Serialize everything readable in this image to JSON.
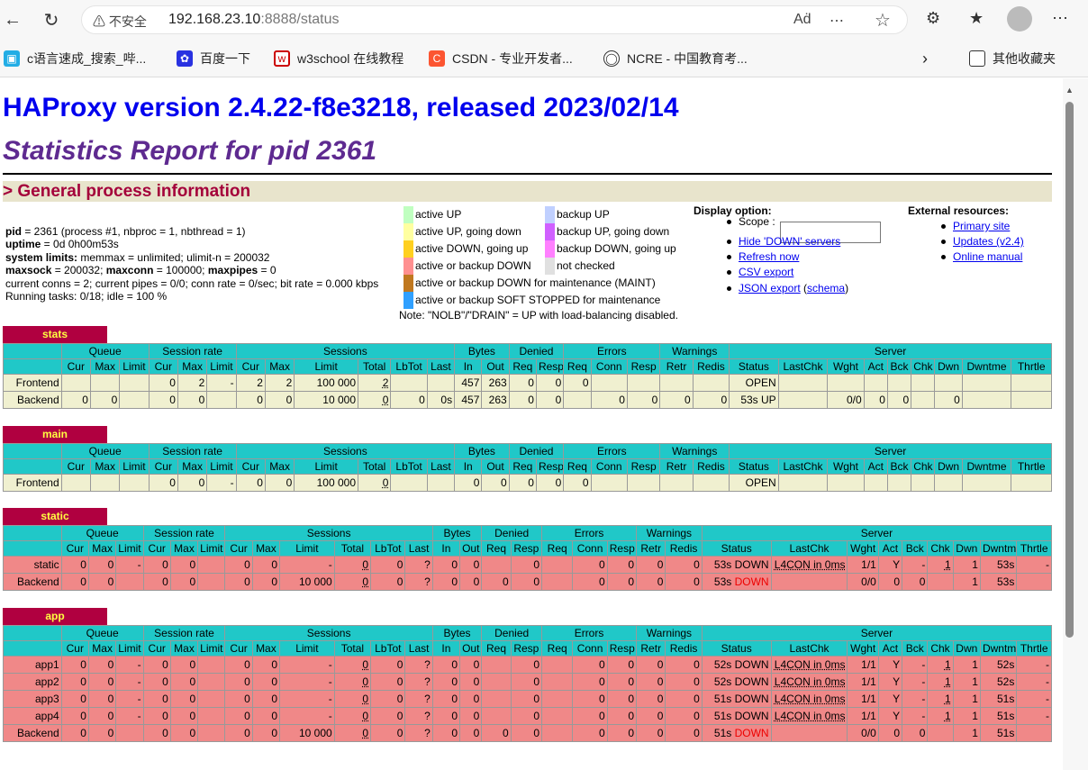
{
  "browser": {
    "security": "不安全",
    "url_host": "192.168.23.10",
    "url_rest": ":8888/status"
  },
  "bookmarks": [
    "c语言速成_搜索_哔...",
    "百度一下",
    "w3school 在线教程",
    "CSDN - 专业开发者...",
    "NCRE - 中国教育考...",
    "其他收藏夹"
  ],
  "page": {
    "title": "HAProxy version 2.4.22-f8e3218, released 2023/02/14",
    "subtitle": "Statistics Report for pid 2361",
    "section": "> General process information"
  },
  "proc": {
    "l1b": "pid",
    "l1": " = 2361 (process #1, nbproc = 1, nbthread = 1)",
    "l2b": "uptime",
    "l2": " = 0d 0h00m53s",
    "l3b": "system limits:",
    "l3": " memmax = unlimited; ulimit-n = 200032",
    "l4b1": "maxsock",
    "l4a": " = 200032; ",
    "l4b2": "maxconn",
    "l4c": " = 100000; ",
    "l4b3": "maxpipes",
    "l4d": " = 0",
    "l5": "current conns = 2; current pipes = 0/0; conn rate = 0/sec; bit rate = 0.000 kbps",
    "l6": "Running tasks: 0/18; idle = 100 %"
  },
  "legend": [
    {
      "label": "active UP",
      "color": "#c0ffc0"
    },
    {
      "label": "active UP, going down",
      "color": "#ffffa0"
    },
    {
      "label": "active DOWN, going up",
      "color": "#ffd020"
    },
    {
      "label": "active or backup DOWN",
      "color": "#ff9090"
    },
    {
      "label": "active or backup DOWN for maintenance (MAINT)",
      "color": "#c07820"
    },
    {
      "label": "active or backup SOFT STOPPED for maintenance",
      "color": "#30a0ff"
    },
    {
      "label": "backup UP",
      "color": "#c0d0ff"
    },
    {
      "label": "backup UP, going down",
      "color": "#d060ff"
    },
    {
      "label": "backup DOWN, going up",
      "color": "#ff80ff"
    },
    {
      "label": "not checked",
      "color": "#e0e0e0"
    }
  ],
  "legend_note": "Note: \"NOLB\"/\"DRAIN\" = UP with load-balancing disabled.",
  "display": {
    "title": "Display option:",
    "scope": "Scope :",
    "hide": "Hide 'DOWN' servers",
    "refresh": "Refresh now",
    "csv": "CSV export",
    "json": "JSON export",
    "schema": "schema"
  },
  "external": {
    "title": "External resources:",
    "primary": "Primary site",
    "updates": "Updates (v2.4)",
    "manual": "Online manual"
  },
  "proxies": {
    "stats": "stats",
    "main": "main",
    "static": "static",
    "app": "app"
  },
  "headers": {
    "queue": "Queue",
    "srate": "Session rate",
    "sessions": "Sessions",
    "bytes": "Bytes",
    "denied": "Denied",
    "errors": "Errors",
    "warnings": "Warnings",
    "server": "Server",
    "sub": [
      "Cur",
      "Max",
      "Limit",
      "Cur",
      "Max",
      "Limit",
      "Cur",
      "Max",
      "Limit",
      "Total",
      "LbTot",
      "Last",
      "In",
      "Out",
      "Req",
      "Resp",
      "Req",
      "Conn",
      "Resp",
      "Retr",
      "Redis",
      "Status",
      "LastChk",
      "Wght",
      "Act",
      "Bck",
      "Chk",
      "Dwn",
      "Dwntme",
      "Thrtle"
    ]
  },
  "rows": {
    "stats": [
      [
        "Frontend",
        "",
        "",
        "",
        "0",
        "2",
        "-",
        "2",
        "2",
        "100 000",
        "2",
        "",
        "",
        "457",
        "263",
        "0",
        "0",
        "0",
        "",
        "",
        "",
        "",
        "OPEN",
        "",
        "",
        "",
        "",
        "",
        "",
        "",
        ""
      ],
      [
        "Backend",
        "0",
        "0",
        "",
        "0",
        "0",
        "",
        "0",
        "0",
        "10 000",
        "0",
        "0",
        "0s",
        "457",
        "263",
        "0",
        "0",
        "",
        "0",
        "0",
        "0",
        "0",
        "53s UP",
        "",
        "0/0",
        "0",
        "0",
        "",
        "0",
        "",
        ""
      ]
    ],
    "main": [
      [
        "Frontend",
        "",
        "",
        "",
        "0",
        "0",
        "-",
        "0",
        "0",
        "100 000",
        "0",
        "",
        "",
        "0",
        "0",
        "0",
        "0",
        "0",
        "",
        "",
        "",
        "",
        "OPEN",
        "",
        "",
        "",
        "",
        "",
        "",
        "",
        ""
      ]
    ],
    "static": [
      [
        "static",
        "0",
        "0",
        "-",
        "0",
        "0",
        "",
        "0",
        "0",
        "-",
        "0",
        "0",
        "?",
        "0",
        "0",
        "",
        "0",
        "",
        "0",
        "0",
        "0",
        "0",
        "53s DOWN",
        "L4CON in 0ms",
        "1/1",
        "Y",
        "-",
        "1",
        "1",
        "53s",
        "-"
      ],
      [
        "Backend",
        "0",
        "0",
        "",
        "0",
        "0",
        "",
        "0",
        "0",
        "10 000",
        "0",
        "0",
        "?",
        "0",
        "0",
        "0",
        "0",
        "",
        "0",
        "0",
        "0",
        "0",
        "53s DOWN",
        "",
        "0/0",
        "0",
        "0",
        "",
        "1",
        "53s",
        ""
      ]
    ],
    "app": [
      [
        "app1",
        "0",
        "0",
        "-",
        "0",
        "0",
        "",
        "0",
        "0",
        "-",
        "0",
        "0",
        "?",
        "0",
        "0",
        "",
        "0",
        "",
        "0",
        "0",
        "0",
        "0",
        "52s DOWN",
        "L4CON in 0ms",
        "1/1",
        "Y",
        "-",
        "1",
        "1",
        "52s",
        "-"
      ],
      [
        "app2",
        "0",
        "0",
        "-",
        "0",
        "0",
        "",
        "0",
        "0",
        "-",
        "0",
        "0",
        "?",
        "0",
        "0",
        "",
        "0",
        "",
        "0",
        "0",
        "0",
        "0",
        "52s DOWN",
        "L4CON in 0ms",
        "1/1",
        "Y",
        "-",
        "1",
        "1",
        "52s",
        "-"
      ],
      [
        "app3",
        "0",
        "0",
        "-",
        "0",
        "0",
        "",
        "0",
        "0",
        "-",
        "0",
        "0",
        "?",
        "0",
        "0",
        "",
        "0",
        "",
        "0",
        "0",
        "0",
        "0",
        "51s DOWN",
        "L4CON in 0ms",
        "1/1",
        "Y",
        "-",
        "1",
        "1",
        "51s",
        "-"
      ],
      [
        "app4",
        "0",
        "0",
        "-",
        "0",
        "0",
        "",
        "0",
        "0",
        "-",
        "0",
        "0",
        "?",
        "0",
        "0",
        "",
        "0",
        "",
        "0",
        "0",
        "0",
        "0",
        "51s DOWN",
        "L4CON in 0ms",
        "1/1",
        "Y",
        "-",
        "1",
        "1",
        "51s",
        "-"
      ],
      [
        "Backend",
        "0",
        "0",
        "",
        "0",
        "0",
        "",
        "0",
        "0",
        "10 000",
        "0",
        "0",
        "?",
        "0",
        "0",
        "0",
        "0",
        "",
        "0",
        "0",
        "0",
        "0",
        "51s DOWN",
        "",
        "0/0",
        "0",
        "0",
        "",
        "1",
        "51s",
        ""
      ]
    ]
  }
}
